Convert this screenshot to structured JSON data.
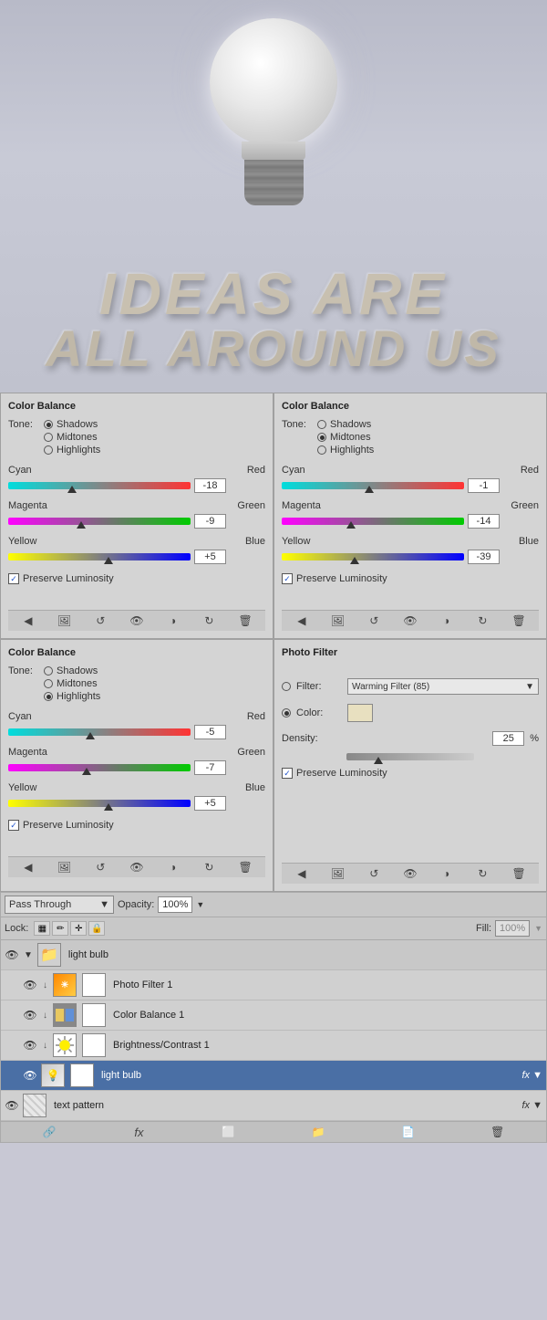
{
  "hero": {
    "line1": "IDEAS ARE",
    "line2": "ALL AROUND US"
  },
  "panel_top_left": {
    "title": "Color Balance",
    "tone_label": "Tone:",
    "tones": [
      "Shadows",
      "Midtones",
      "Highlights"
    ],
    "selected_tone": 0,
    "sliders": [
      {
        "left": "Cyan",
        "right": "Red",
        "value": "-18",
        "thumb_pct": 35
      },
      {
        "left": "Magenta",
        "right": "Green",
        "value": "-9",
        "thumb_pct": 40
      },
      {
        "left": "Yellow",
        "right": "Blue",
        "value": "+5",
        "thumb_pct": 55
      }
    ],
    "preserve": "Preserve Luminosity"
  },
  "panel_top_right": {
    "title": "Color Balance",
    "tone_label": "Tone:",
    "tones": [
      "Shadows",
      "Midtones",
      "Highlights"
    ],
    "selected_tone": 1,
    "sliders": [
      {
        "left": "Cyan",
        "right": "Red",
        "value": "-1",
        "thumb_pct": 48
      },
      {
        "left": "Magenta",
        "right": "Green",
        "value": "-14",
        "thumb_pct": 38
      },
      {
        "left": "Yellow",
        "right": "Blue",
        "value": "-39",
        "thumb_pct": 40
      }
    ],
    "preserve": "Preserve Luminosity"
  },
  "panel_bot_left": {
    "title": "Color Balance",
    "tone_label": "Tone:",
    "tones": [
      "Shadows",
      "Midtones",
      "Highlights"
    ],
    "selected_tone": 2,
    "sliders": [
      {
        "left": "Cyan",
        "right": "Red",
        "value": "-5",
        "thumb_pct": 45
      },
      {
        "left": "Magenta",
        "right": "Green",
        "value": "-7",
        "thumb_pct": 43
      },
      {
        "left": "Yellow",
        "right": "Blue",
        "value": "+5",
        "thumb_pct": 55
      }
    ],
    "preserve": "Preserve Luminosity"
  },
  "panel_bot_right": {
    "title": "Photo Filter",
    "filter_label": "Filter:",
    "filter_value": "Warming Filter (85)",
    "color_label": "Color:",
    "density_label": "Density:",
    "density_value": "25",
    "density_pct": "%",
    "preserve": "Preserve Luminosity"
  },
  "layers": {
    "blend_mode": "Pass Through",
    "blend_mode_arrow": "▼",
    "opacity_label": "Opacity:",
    "opacity_value": "100%",
    "opacity_arrow": "▼",
    "lock_label": "Lock:",
    "fill_label": "Fill:",
    "fill_value": "100%",
    "fill_arrow": "▼",
    "items": [
      {
        "visible": true,
        "type": "group",
        "name": "light bulb",
        "is_group": true
      },
      {
        "visible": true,
        "type": "photo_filter",
        "name": "Photo Filter 1",
        "has_mask": true
      },
      {
        "visible": true,
        "type": "color_balance",
        "name": "Color Balance 1",
        "has_mask": true
      },
      {
        "visible": true,
        "type": "brightness",
        "name": "Brightness/Contrast 1",
        "has_mask": true
      },
      {
        "visible": true,
        "type": "image",
        "name": "light bulb",
        "is_link": true,
        "has_fx": true
      },
      {
        "visible": true,
        "type": "textpat",
        "name": "text pattern",
        "has_fx": true
      }
    ]
  }
}
